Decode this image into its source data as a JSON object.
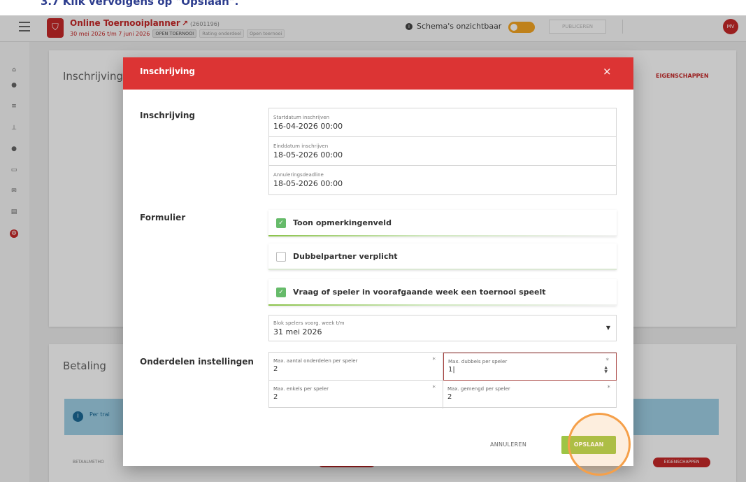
{
  "caption": {
    "text": "3.7 Klik vervolgens op \"Opslaan\"."
  },
  "topbar": {
    "app_name": "Online Toernooiplanner",
    "external_icon": "external-link-icon",
    "tournament_id": "(2601196)",
    "dates": "30 mei 2026 t/m 7 juni 2026",
    "chips": [
      "OPEN TOERNOOI",
      "Rating onderdeel",
      "Open toernooi"
    ],
    "schedule_status": "Schema's onzichtbaar",
    "publish_label": "PUBLICEREN",
    "avatar_initials": "MV"
  },
  "sidebar": {
    "icons": [
      "home-icon",
      "users-icon",
      "list-icon",
      "bracket-icon",
      "globe-icon",
      "monitor-icon",
      "mail-icon",
      "document-icon",
      "settings-icon"
    ],
    "active": "settings-icon"
  },
  "background": {
    "card1_title": "Inschrijving",
    "card1_action": "EIGENSCHAPPEN",
    "card2_title": "Betaling",
    "info_text": "Per trai",
    "betaalmethode_label": "BETAALMETHO",
    "card2_action": "EIGENSCHAPPEN"
  },
  "modal": {
    "title": "Inschrijving",
    "close": "×",
    "sections": {
      "inschrijving": "Inschrijving",
      "formulier": "Formulier",
      "onderdelen": "Onderdelen instellingen"
    },
    "dates": [
      {
        "label": "Startdatum inschrijven",
        "value": "16-04-2026 00:00"
      },
      {
        "label": "Einddatum inschrijven",
        "value": "18-05-2026 00:00"
      },
      {
        "label": "Annuleringsdeadline",
        "value": "18-05-2026 00:00"
      }
    ],
    "checkboxes": [
      {
        "label": "Toon opmerkingenveld",
        "checked": true
      },
      {
        "label": "Dubbelpartner verplicht",
        "checked": false
      },
      {
        "label": "Vraag of speler in voorafgaande week een toernooi speelt",
        "checked": true
      }
    ],
    "block_select": {
      "label": "Blok spelers voorg. week t/m",
      "value": "31 mei 2026"
    },
    "limits": {
      "max_onderdelen": {
        "label": "Max. aantal onderdelen per speler",
        "value": "2",
        "required": "*"
      },
      "max_dubbels": {
        "label": "Max. dubbels per speler",
        "value": "1|",
        "required": "*"
      },
      "max_enkels": {
        "label": "Max. enkels per speler",
        "value": "2",
        "required": "*"
      },
      "max_gemengd": {
        "label": "Max. gemengd per speler",
        "value": "2",
        "required": "*"
      }
    },
    "cancel_label": "ANNULEREN",
    "save_label": "OPSLAAN"
  },
  "colors": {
    "header_red": "#dc3434",
    "save_green": "#9ec545",
    "check_green": "#66bb6a",
    "highlight_orange": "#f5a04a"
  }
}
